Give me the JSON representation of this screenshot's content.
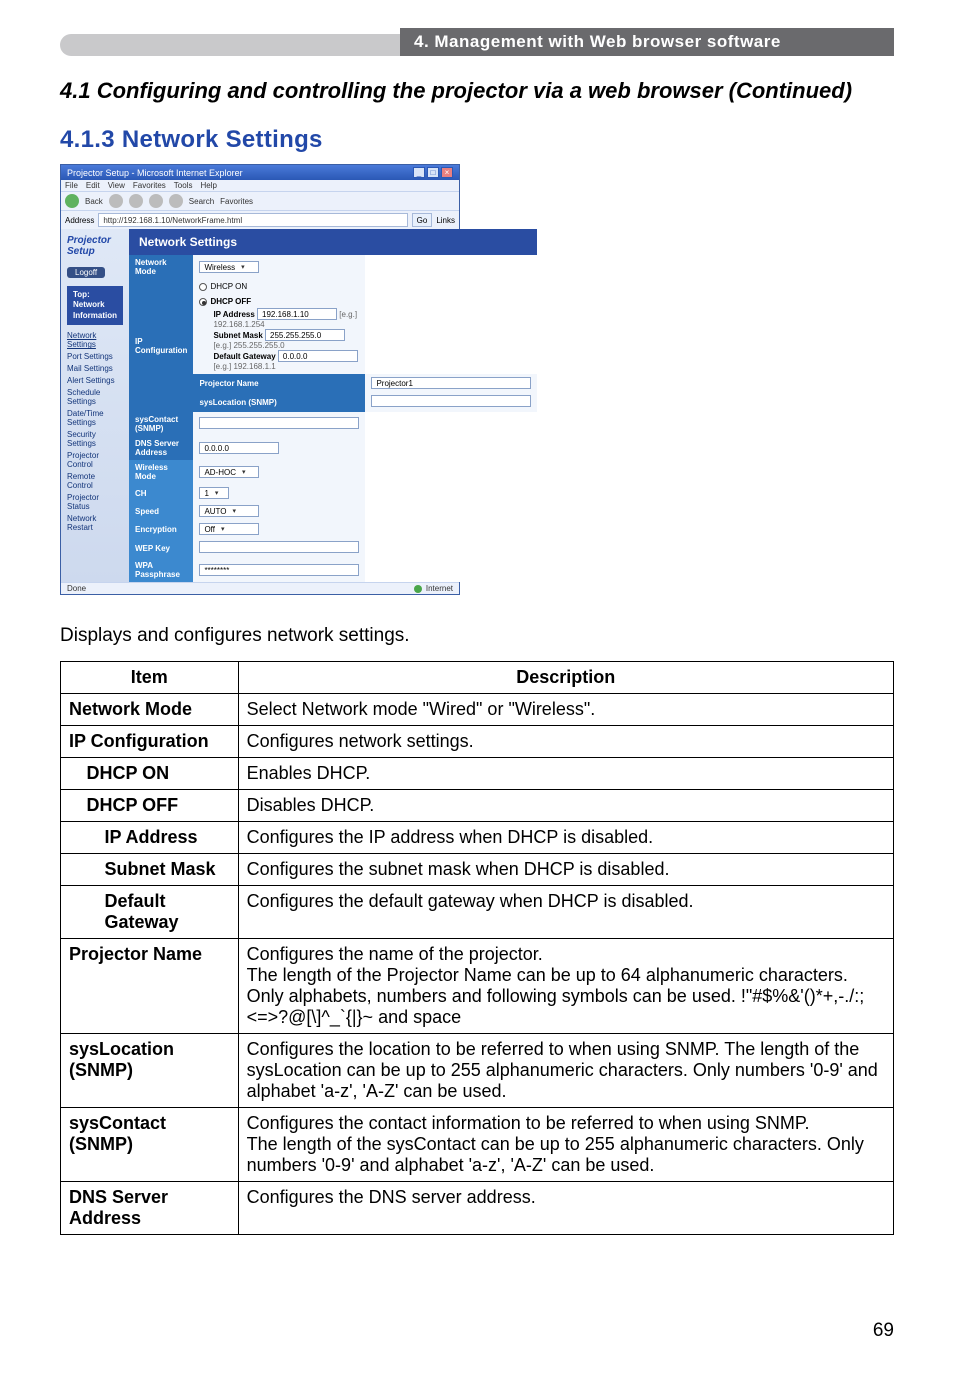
{
  "header": {
    "title": "4. Management with Web browser software"
  },
  "continuedTitle": "4.1 Configuring and controlling the projector via a web browser (Continued)",
  "subsection": "4.1.3 Network Settings",
  "ie": {
    "title": "Projector Setup - Microsoft Internet Explorer",
    "menus": [
      "File",
      "Edit",
      "View",
      "Favorites",
      "Tools",
      "Help"
    ],
    "back": "Back",
    "search": "Search",
    "favorites": "Favorites",
    "addressLabel": "Address",
    "addressValue": "http://192.168.1.10/NetworkFrame.html",
    "go": "Go",
    "links": "Links",
    "done": "Done",
    "zone": "Internet"
  },
  "sidebar": {
    "projectorSetup": "Projector Setup",
    "logoff": "Logoff",
    "topTitle": "Top:\nNetwork\nInformation",
    "items": [
      "Network Settings",
      "Port Settings",
      "Mail Settings",
      "Alert Settings",
      "Schedule Settings",
      "Date/Time Settings",
      "Security Settings",
      "Projector Control",
      "Remote Control",
      "Projector Status",
      "Network Restart"
    ]
  },
  "panel": {
    "heading": "Network Settings",
    "rows": {
      "networkMode": "Network Mode",
      "networkModeVal": "Wireless",
      "ipConfiguration": "IP Configuration",
      "dhcpOn": "DHCP ON",
      "dhcpOff": "DHCP OFF",
      "ipAddressLbl": "IP Address",
      "ipAddressVal": "192.168.1.10",
      "ipAddressEg": "[e.g.] 192.168.1.254",
      "subnetLbl": "Subnet Mask",
      "subnetVal": "255.255.255.0",
      "subnetEg": "[e.g.] 255.255.255.0",
      "gatewayLbl": "Default Gateway",
      "gatewayVal": "0.0.0.0",
      "gatewayEg": "[e.g.] 192.168.1.1",
      "projectorName": "Projector Name",
      "projectorNameVal": "Projector1",
      "sysLocation": "sysLocation (SNMP)",
      "sysContact": "sysContact (SNMP)",
      "dnsServer": "DNS Server Address",
      "dnsServerVal": "0.0.0.0",
      "wirelessMode": "Wireless Mode",
      "wirelessModeVal": "AD-HOC",
      "ch": "CH",
      "chVal": "1",
      "speed": "Speed",
      "speedVal": "AUTO",
      "encryption": "Encryption",
      "encryptionVal": "Off",
      "wepKey": "WEP Key",
      "wpa": "WPA Passphrase",
      "wpaVal": "********"
    }
  },
  "intro": "Displays and configures network settings.",
  "table": {
    "hItem": "Item",
    "hDesc": "Description",
    "r1i": "Network Mode",
    "r1d": "Select Network mode \"Wired\" or \"Wireless\".",
    "r2i": "IP Configuration",
    "r2d": "Configures network settings.",
    "r3i": "DHCP ON",
    "r3d": "Enables DHCP.",
    "r4i": "DHCP OFF",
    "r4d": "Disables DHCP.",
    "r5i": "IP Address",
    "r5d": "Configures the IP address when DHCP is disabled.",
    "r6i": "Subnet Mask",
    "r6d": "Configures the subnet mask when DHCP is disabled.",
    "r7i": "Default Gateway",
    "r7d": "Configures the default gateway when DHCP is disabled.",
    "r8i": "Projector Name",
    "r8d": "Configures the name of the projector.\nThe length of the Projector Name can be up to 64 alphanumeric characters. Only alphabets, numbers and following symbols can be used.  !\"#$%&'()*+,-./:;<=>?@[\\]^_`{|}~ and space",
    "r9i": "sysLocation (SNMP)",
    "r9d": "Configures the location to be referred to when using SNMP. The length of the sysLocation can be up to 255 alphanumeric characters. Only numbers '0-9' and alphabet 'a-z', 'A-Z' can be used.",
    "r10i": "sysContact (SNMP)",
    "r10d": "Configures the contact information to be referred to when using SNMP.\nThe length of the sysContact can be up to 255 alphanumeric characters. Only numbers '0-9' and alphabet 'a-z', 'A-Z' can be used.",
    "r11i": "DNS Server Address",
    "r11d": "Configures the DNS  server address."
  },
  "pageNumber": "69"
}
